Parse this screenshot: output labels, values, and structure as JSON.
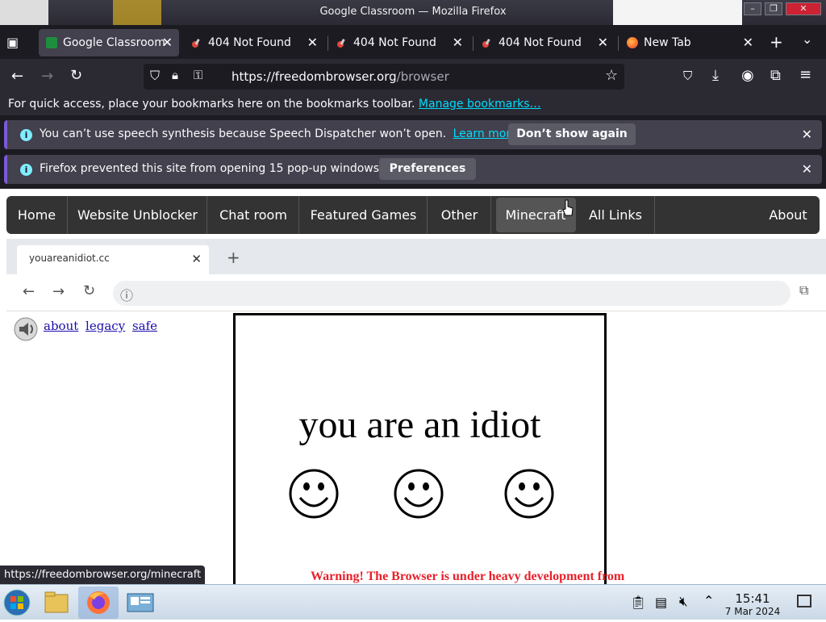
{
  "window": {
    "title": "Google Classroom — Mozilla Firefox",
    "controls": [
      "–",
      "❐",
      "✕"
    ]
  },
  "tabs": [
    {
      "label": "Google Classroom",
      "active": true,
      "icon": "classroom-icon"
    },
    {
      "label": "404 Not Found",
      "active": false,
      "icon": "pin-icon"
    },
    {
      "label": "404 Not Found",
      "active": false,
      "icon": "pin-icon"
    },
    {
      "label": "404 Not Found",
      "active": false,
      "icon": "pin-icon"
    },
    {
      "label": "New Tab",
      "active": false,
      "icon": "firefox-icon"
    }
  ],
  "tab_controls": {
    "new_tab": "+",
    "list_all": "⌄"
  },
  "navbar": {
    "url_base": "https://freedombrowser.org",
    "url_path": "/browser"
  },
  "bookmarks_bar": {
    "text": "For quick access, place your bookmarks here on the bookmarks toolbar.",
    "link": "Manage bookmarks…"
  },
  "notifications": [
    {
      "message": "You can’t use speech synthesis because Speech Dispatcher won’t open.",
      "link": "Learn more",
      "button": "Don’t show again"
    },
    {
      "message": "Firefox prevented this site from opening 15 pop-up windows.",
      "link": "",
      "button": "Preferences"
    }
  ],
  "site_menu": {
    "items": [
      "Home",
      "Website Unblocker",
      "Chat room",
      "Featured Games",
      "Other",
      "Minecraft",
      "All Links"
    ],
    "right_item": "About",
    "hovered": "Minecraft"
  },
  "inner_browser": {
    "tab_label": "youareanidiot.cc",
    "new_tab": "+"
  },
  "content": {
    "top_links": [
      "about",
      "legacy",
      "safe"
    ],
    "headline": "you are an idiot",
    "warning": "Warning! The Browser is under heavy development from"
  },
  "status_url": "https://freedombrowser.org/minecraft",
  "taskbar": {
    "time": "15:41",
    "date": "7 Mar 2024"
  },
  "colors": {
    "chrome_dark": "#1c1b22",
    "chrome_mid": "#2b2a33",
    "link_cyan": "#00ddff",
    "menu_bg": "#333333",
    "warning_red": "#e8212a"
  }
}
